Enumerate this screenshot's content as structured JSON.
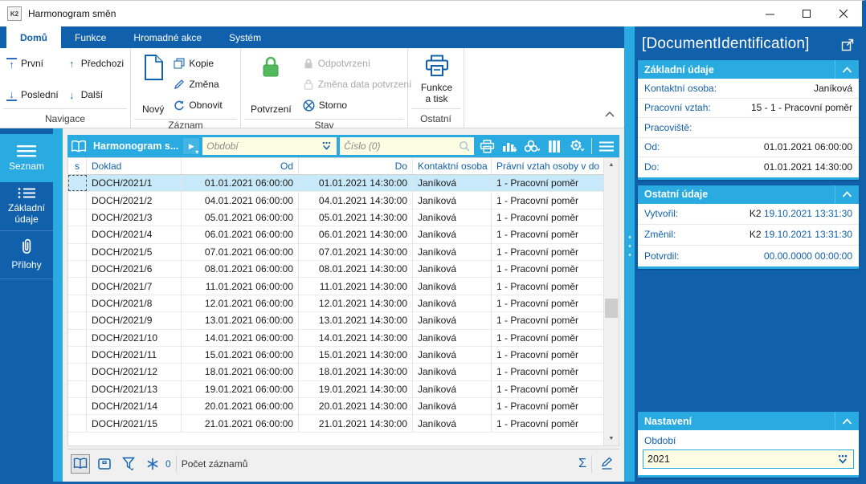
{
  "colors": {
    "accent_blue": "#1160ab",
    "accent_cyan": "#29abe2",
    "input_bg": "#fdfde3",
    "selection": "#c8e9f9",
    "green": "#50b75a",
    "icon_blue": "#2a6cc0"
  },
  "window": {
    "title": "Harmonogram směn",
    "app_icon": "K2"
  },
  "ribbon": {
    "tabs": [
      {
        "label": "Domů"
      },
      {
        "label": "Funkce"
      },
      {
        "label": "Hromadné akce"
      },
      {
        "label": "Systém"
      }
    ],
    "groups": [
      {
        "name": "Navigace",
        "buttons": [
          {
            "label": "První"
          },
          {
            "label": "Poslední"
          },
          {
            "label": "Předchozi"
          },
          {
            "label": "Další"
          }
        ]
      },
      {
        "name": "Záznam",
        "big_label": "Nový",
        "small": [
          {
            "label": "Kopie"
          },
          {
            "label": "Změna"
          },
          {
            "label": "Obnovit"
          }
        ]
      },
      {
        "name": "Stav",
        "big_label": "Potvrzení",
        "small": [
          {
            "label": "Odpotvrzení"
          },
          {
            "label": "Změna data potvrzení"
          },
          {
            "label": "Storno"
          }
        ]
      },
      {
        "name": "Ostatní",
        "big_label": "Funkce a tisk"
      }
    ]
  },
  "sidebar": {
    "items": [
      {
        "label": "Seznam"
      },
      {
        "label": "Základní údaje"
      },
      {
        "label": "Přílohy"
      }
    ]
  },
  "browse": {
    "toolbar": {
      "list_title": "Harmonogram s...",
      "period_placeholder": "Období",
      "search_placeholder": "Číslo (0)"
    },
    "table": {
      "columns": [
        "s",
        "Doklad",
        "Od",
        "Do",
        "Kontaktní osoba",
        "Právní vztah osoby v do"
      ],
      "selected_index": 0,
      "rows": [
        [
          "DOCH/2021/1",
          "01.01.2021 06:00:00",
          "01.01.2021 14:30:00",
          "Janíková",
          "1 - Pracovní poměr"
        ],
        [
          "DOCH/2021/2",
          "04.01.2021 06:00:00",
          "04.01.2021 14:30:00",
          "Janíková",
          "1 - Pracovní poměr"
        ],
        [
          "DOCH/2021/3",
          "05.01.2021 06:00:00",
          "05.01.2021 14:30:00",
          "Janíková",
          "1 - Pracovní poměr"
        ],
        [
          "DOCH/2021/4",
          "06.01.2021 06:00:00",
          "06.01.2021 14:30:00",
          "Janíková",
          "1 - Pracovní poměr"
        ],
        [
          "DOCH/2021/5",
          "07.01.2021 06:00:00",
          "07.01.2021 14:30:00",
          "Janíková",
          "1 - Pracovní poměr"
        ],
        [
          "DOCH/2021/6",
          "08.01.2021 06:00:00",
          "08.01.2021 14:30:00",
          "Janíková",
          "1 - Pracovní poměr"
        ],
        [
          "DOCH/2021/7",
          "11.01.2021 06:00:00",
          "11.01.2021 14:30:00",
          "Janíková",
          "1 - Pracovní poměr"
        ],
        [
          "DOCH/2021/8",
          "12.01.2021 06:00:00",
          "12.01.2021 14:30:00",
          "Janíková",
          "1 - Pracovní poměr"
        ],
        [
          "DOCH/2021/9",
          "13.01.2021 06:00:00",
          "13.01.2021 14:30:00",
          "Janíková",
          "1 - Pracovní poměr"
        ],
        [
          "DOCH/2021/10",
          "14.01.2021 06:00:00",
          "14.01.2021 14:30:00",
          "Janíková",
          "1 - Pracovní poměr"
        ],
        [
          "DOCH/2021/11",
          "15.01.2021 06:00:00",
          "15.01.2021 14:30:00",
          "Janíková",
          "1 - Pracovní poměr"
        ],
        [
          "DOCH/2021/12",
          "18.01.2021 06:00:00",
          "18.01.2021 14:30:00",
          "Janíková",
          "1 - Pracovní poměr"
        ],
        [
          "DOCH/2021/13",
          "19.01.2021 06:00:00",
          "19.01.2021 14:30:00",
          "Janíková",
          "1 - Pracovní poměr"
        ],
        [
          "DOCH/2021/14",
          "20.01.2021 06:00:00",
          "20.01.2021 14:30:00",
          "Janíková",
          "1 - Pracovní poměr"
        ],
        [
          "DOCH/2021/15",
          "21.01.2021 06:00:00",
          "21.01.2021 14:30:00",
          "Janíková",
          "1 - Pracovní poměr"
        ]
      ]
    },
    "statusbar": {
      "count_value": "0",
      "count_label": "Počet záznamů"
    }
  },
  "panel": {
    "title": "[DocumentIdentification]",
    "sections": [
      {
        "title": "Základní údaje",
        "fields": [
          {
            "label": "Kontaktní osoba:",
            "value": "Janíková"
          },
          {
            "label": "Pracovní vztah:",
            "value": "15 - 1 - Pracovní poměr"
          },
          {
            "label": "Pracoviště:",
            "value": ""
          },
          {
            "label": "Od:",
            "value": "01.01.2021 06:00:00"
          },
          {
            "label": "Do:",
            "value": "01.01.2021 14:30:00"
          }
        ]
      },
      {
        "title": "Ostatní údaje",
        "fields": [
          {
            "label": "Vytvořil:",
            "prefix": "K2",
            "value": "19.10.2021 13:31:30"
          },
          {
            "label": "Změnil:",
            "prefix": "K2",
            "value": "19.10.2021 13:31:30"
          },
          {
            "label": "Potvrdil:",
            "prefix": "",
            "value": "00.00.0000 00:00:00"
          }
        ]
      },
      {
        "title": "Nastavení",
        "field_label": "Období",
        "field_value": "2021"
      }
    ]
  }
}
